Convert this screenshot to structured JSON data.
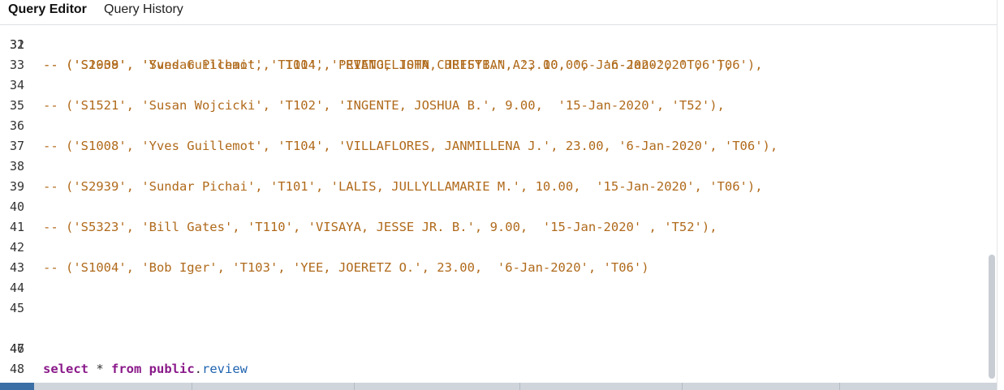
{
  "tabs": {
    "query_editor": "Query Editor",
    "query_history": "Query History"
  },
  "editor": {
    "partial_line": {
      "number": "31",
      "text": "-- ('S1008', 'Yves Guillemot', 'T104', 'EVANGELISTA, JEFFYB.', 23.00, '6-Jan-2020', 'T06'),"
    },
    "lines": [
      {
        "number": "32",
        "text": ""
      },
      {
        "number": "33",
        "text": "-- ('S2939', 'Sundar Pichai', 'T101', 'PRIETO, JOHN CHRISTIAN A', 10.00,  '6-Jan-2020', 'T06'),"
      },
      {
        "number": "34",
        "text": ""
      },
      {
        "number": "35",
        "text": "-- ('S1521', 'Susan Wojcicki', 'T102', 'INGENTE, JOSHUA B.', 9.00,  '15-Jan-2020', 'T52'),"
      },
      {
        "number": "36",
        "text": ""
      },
      {
        "number": "37",
        "text": "-- ('S1008', 'Yves Guillemot', 'T104', 'VILLAFLORES, JANMILLENA J.', 23.00, '6-Jan-2020', 'T06'),"
      },
      {
        "number": "38",
        "text": ""
      },
      {
        "number": "39",
        "text": "-- ('S2939', 'Sundar Pichai', 'T101', 'LALIS, JULLYLLAMARIE M.', 10.00,  '15-Jan-2020', 'T06'),"
      },
      {
        "number": "40",
        "text": ""
      },
      {
        "number": "41",
        "text": "-- ('S5323', 'Bill Gates', 'T110', 'VISAYA, JESSE JR. B.', 9.00,  '15-Jan-2020' , 'T52'),"
      },
      {
        "number": "42",
        "text": ""
      },
      {
        "number": "43",
        "text": "-- ('S1004', 'Bob Iger', 'T103', 'YEE, JOERETZ O.', 23.00,  '6-Jan-2020', 'T06')"
      },
      {
        "number": "44",
        "text": ""
      },
      {
        "number": "45",
        "text": ""
      },
      {
        "number": "46",
        "text": ""
      },
      {
        "number": "47",
        "text": ""
      },
      {
        "number": "48",
        "text": ""
      }
    ],
    "select_statement": {
      "keyword_select": "select",
      "star": " * ",
      "keyword_from": "from",
      "space": " ",
      "schema": "public",
      "dot": ".",
      "table": "review"
    }
  },
  "colors": {
    "comment": "#b06a1b",
    "keyword": "#8a1a8a",
    "identifier": "#1e63b0",
    "scroll_thumb": "#c8cdd3",
    "bottom_accent": "#3b6ea5"
  }
}
